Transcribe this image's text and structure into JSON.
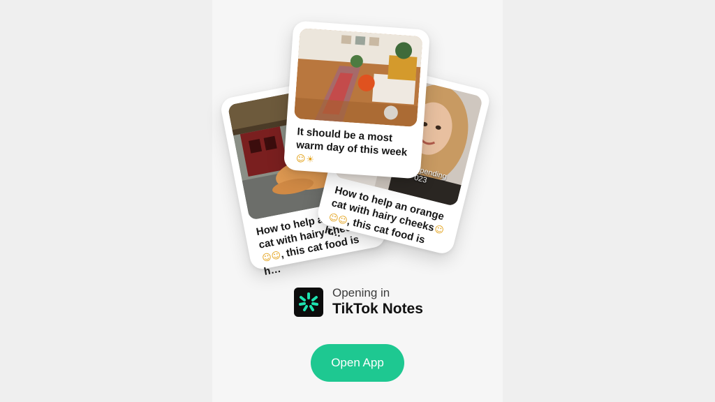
{
  "cards": {
    "left": {
      "caption": "How to help an orange\ncat with hairy cheeks",
      "caption_tail": ", this cat food is h…",
      "emoji_icon": "cat-face-emoji"
    },
    "right": {
      "caption": "How to help an orange\ncat with hairy cheeks",
      "caption_tail": ", this cat food is h…",
      "overlay_text": "spending",
      "overlay_year": "023",
      "emoji_icon": "cat-face-emoji"
    },
    "center": {
      "caption": "It should be a most\nwarm day of this week",
      "emoji_icon": "sun-emoji"
    }
  },
  "brand": {
    "opening_label": "Opening in",
    "app_name": "TikTok Notes",
    "icon": "tiktok-notes-logo-icon",
    "icon_color": "#1ee3b0"
  },
  "cta": {
    "label": "Open App",
    "color": "#1ec891"
  }
}
